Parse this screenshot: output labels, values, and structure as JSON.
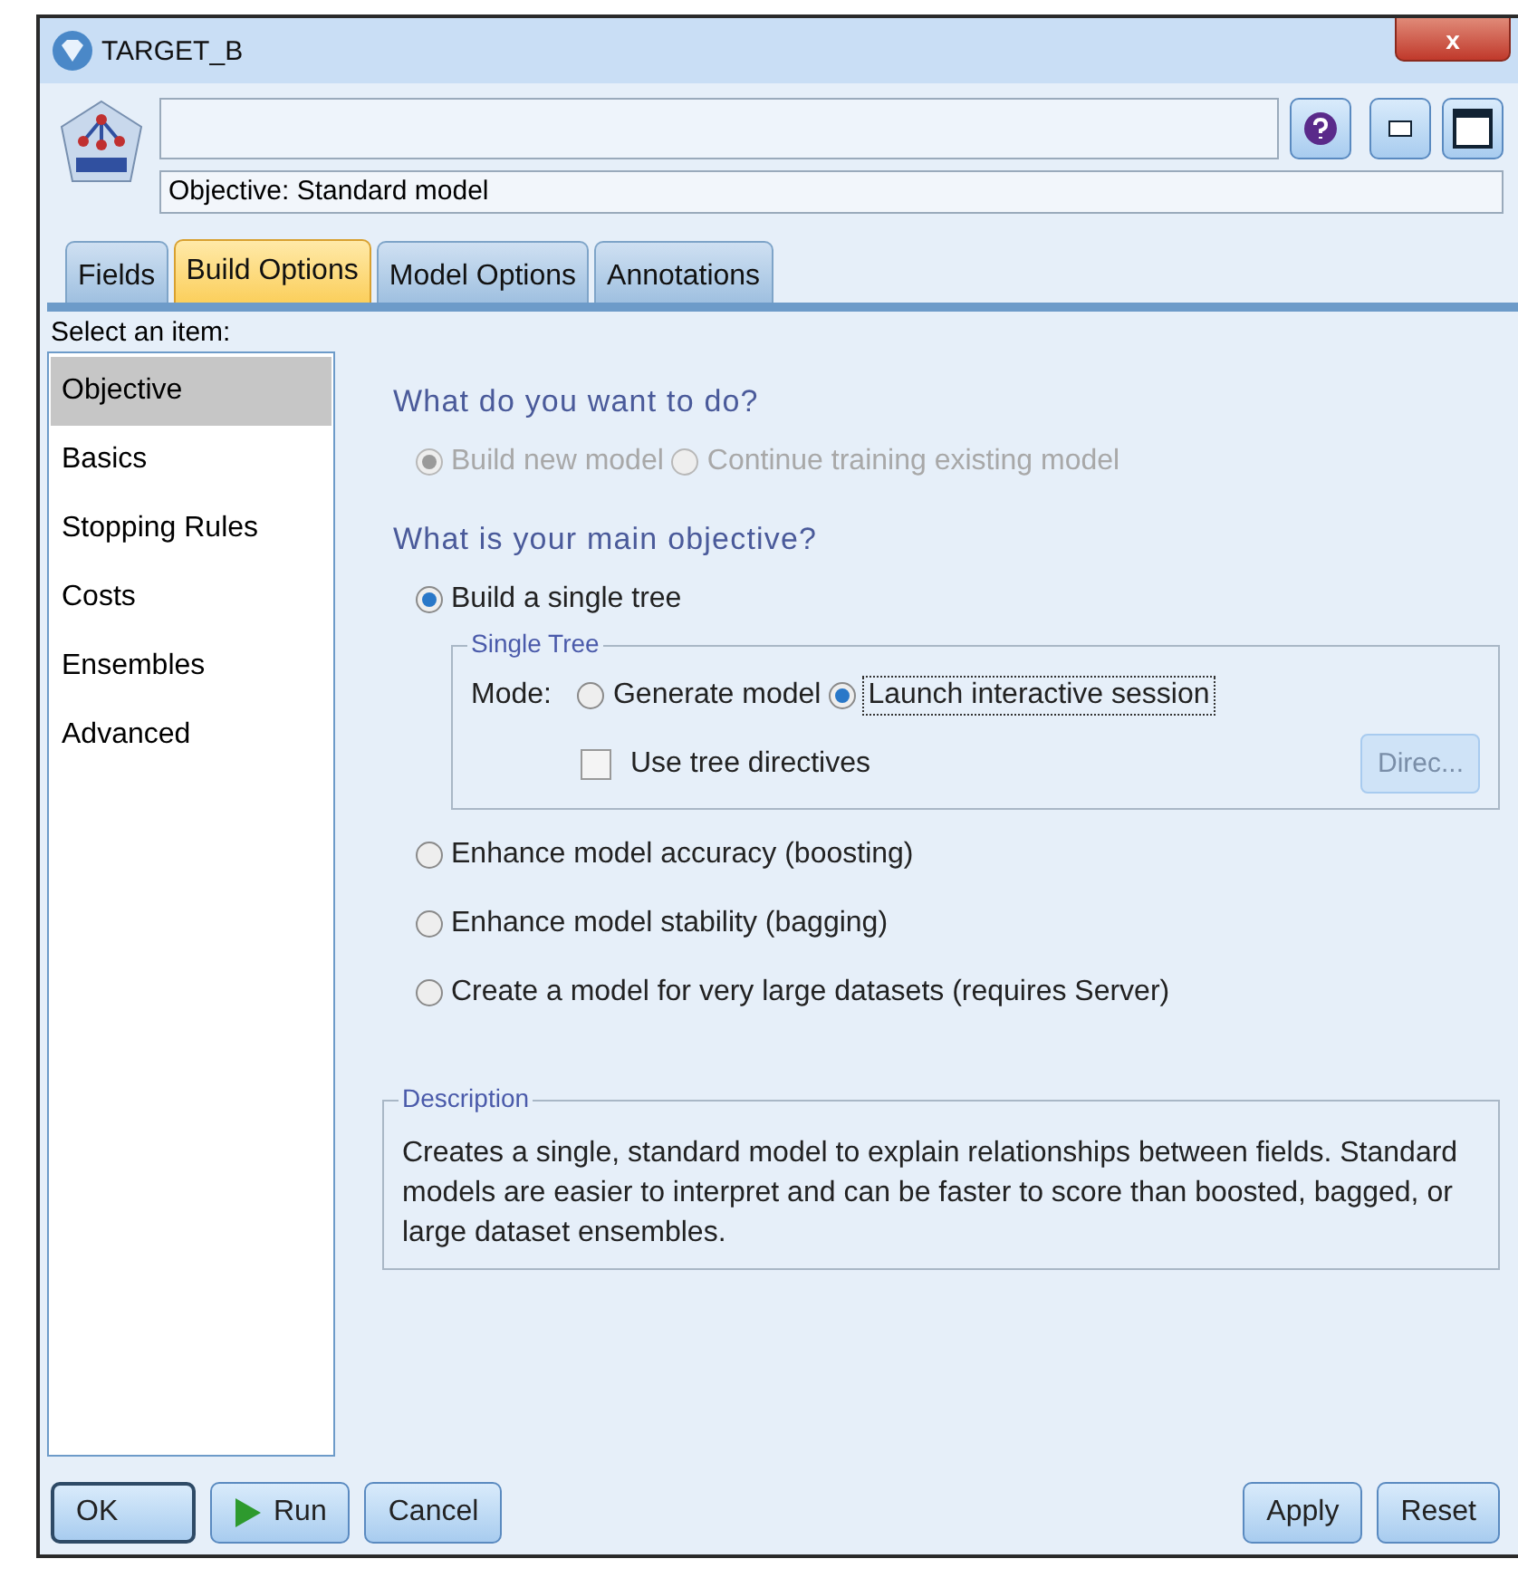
{
  "window": {
    "title": "TARGET_B",
    "close": "x"
  },
  "header": {
    "objective": "Objective: Standard model"
  },
  "tabs": [
    {
      "label": "Fields",
      "selected": false
    },
    {
      "label": "Build Options",
      "selected": true
    },
    {
      "label": "Model Options",
      "selected": false
    },
    {
      "label": "Annotations",
      "selected": false
    }
  ],
  "sidebar": {
    "label": "Select an item:",
    "items": [
      {
        "label": "Objective",
        "selected": true
      },
      {
        "label": "Basics",
        "selected": false
      },
      {
        "label": "Stopping Rules",
        "selected": false
      },
      {
        "label": "Costs",
        "selected": false
      },
      {
        "label": "Ensembles",
        "selected": false
      },
      {
        "label": "Advanced",
        "selected": false
      }
    ]
  },
  "task": {
    "heading": "What do you want to do?",
    "options": [
      {
        "label": "Build new model",
        "selected": true,
        "disabled": true
      },
      {
        "label": "Continue training existing model",
        "selected": false,
        "disabled": true
      }
    ]
  },
  "objective": {
    "heading": "What is your main objective?",
    "first": {
      "label": "Build a single tree",
      "selected": true
    },
    "single_tree": {
      "legend": "Single Tree",
      "mode_label": "Mode:",
      "modes": [
        {
          "label": "Generate model",
          "selected": false
        },
        {
          "label": "Launch interactive session",
          "selected": true
        }
      ],
      "directives": {
        "label": "Use tree directives",
        "checked": false
      },
      "directives_button": {
        "label": "Direc...",
        "disabled": true
      }
    },
    "others": [
      {
        "label": "Enhance model accuracy (boosting)",
        "selected": false
      },
      {
        "label": "Enhance model stability (bagging)",
        "selected": false
      },
      {
        "label": "Create a model for very large datasets (requires Server)",
        "selected": false
      }
    ]
  },
  "description": {
    "legend": "Description",
    "text": "Creates a single, standard model to explain relationships between fields. Standard models are easier to interpret and can be faster to score than boosted, bagged, or large dataset ensembles."
  },
  "buttons_left": [
    {
      "label": "OK",
      "kind": "default"
    },
    {
      "label": "Run",
      "kind": "run"
    },
    {
      "label": "Cancel",
      "kind": "plain"
    }
  ],
  "buttons_right": [
    {
      "label": "Apply",
      "kind": "plain"
    },
    {
      "label": "Reset",
      "kind": "plain"
    }
  ]
}
